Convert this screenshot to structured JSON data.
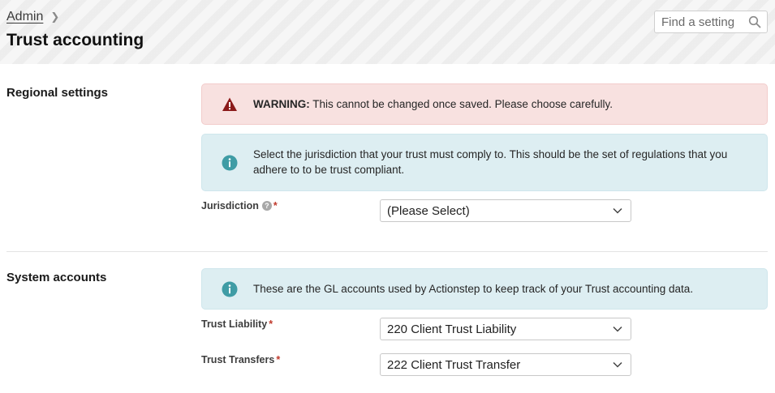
{
  "header": {
    "breadcrumb": "Admin",
    "title": "Trust accounting",
    "search_placeholder": "Find a setting"
  },
  "regional": {
    "section_title": "Regional settings",
    "warning": {
      "label": "WARNING:",
      "text": " This cannot be changed once saved. Please choose carefully."
    },
    "info_text": "Select the jurisdiction that your trust must comply to. This should be the set of regulations that you adhere to to be trust compliant.",
    "jurisdiction": {
      "label": "Jurisdiction",
      "help": "?",
      "required": "*",
      "value": "(Please Select)"
    }
  },
  "system": {
    "section_title": "System accounts",
    "info_text": "These are the GL accounts used by Actionstep to keep track of your Trust accounting data.",
    "trust_liability": {
      "label": "Trust Liability",
      "required": "*",
      "value": "220 Client Trust Liability"
    },
    "trust_transfers": {
      "label": "Trust Transfers",
      "required": "*",
      "value": "222 Client Trust Transfer"
    }
  },
  "colors": {
    "warning_bg": "#f8e1e0",
    "warning_icon": "#8b1a1a",
    "info_bg": "#ddeef2",
    "info_icon": "#3f9ca5",
    "required": "#c0392b"
  }
}
